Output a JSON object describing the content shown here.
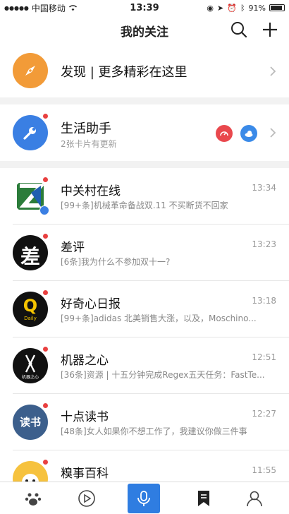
{
  "status_bar": {
    "carrier": "中国移动",
    "time": "13:39",
    "battery": "91%"
  },
  "nav": {
    "title": "我的关注",
    "icons": [
      "search-icon",
      "add-icon"
    ]
  },
  "discover": {
    "label": "发现 | 更多精彩在这里",
    "icon": "compass-icon"
  },
  "helper": {
    "label": "生活助手",
    "sub": "2张卡片有更新",
    "icon": "wrench-icon",
    "mini_icons": [
      "speedometer-icon",
      "weather-icon"
    ]
  },
  "list": [
    {
      "name": "中关村在线",
      "time": "13:34",
      "msg": "[99+条]机械革命备战双.11 不买断货不回家",
      "verified": true
    },
    {
      "name": "差评",
      "time": "13:23",
      "msg": "[6条]我为什么不参加双十一?"
    },
    {
      "name": "好奇心日报",
      "time": "13:18",
      "msg": "[99+条]adidas 北美销售大涨，以及，Moschino..."
    },
    {
      "name": "机器之心",
      "time": "12:51",
      "msg": "[36条]资源 | 十五分钟完成Regex五天任务：FastTe..."
    },
    {
      "name": "十点读书",
      "time": "12:27",
      "msg": "[48条]女人如果你不想工作了，我建议你做三件事"
    },
    {
      "name": "糗事百科",
      "time": "11:55",
      "msg": ""
    }
  ],
  "avatars": {
    "chaping_char": "差",
    "haoqixin_letter": "Q",
    "haoqixin_sub": "Daily",
    "jiqi_sub": "机器之心",
    "shidian_char": "读书"
  },
  "tabs": [
    "home-paw-icon",
    "play-icon",
    "mic-icon",
    "bookmark-icon",
    "profile-icon"
  ],
  "colors": {
    "accent_blue": "#2f7de1",
    "discover_orange": "#f29b38",
    "badge_red": "#e94040"
  }
}
